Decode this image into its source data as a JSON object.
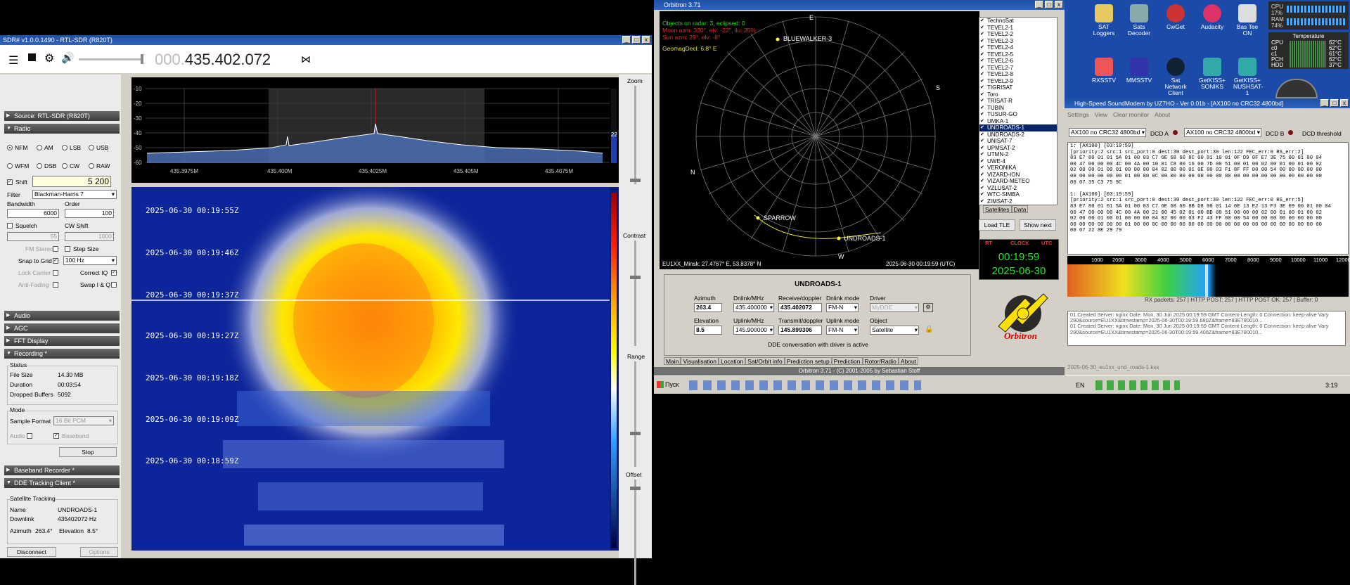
{
  "sdr": {
    "title": "SDR# v1.0.0.1490 - RTL-SDR (R820T)",
    "freq_dim": "000.",
    "freq_main": "435.402.072",
    "sections": {
      "source": "Source: RTL-SDR (R820T)",
      "radio": "Radio",
      "audio": "Audio",
      "agc": "AGC",
      "fft": "FFT Display",
      "recording": "Recording *",
      "baseband": "Baseband Recorder *",
      "dde": "DDE Tracking Client *"
    },
    "modes": [
      "NFM",
      "AM",
      "LSB",
      "USB",
      "WFM",
      "DSB",
      "CW",
      "RAW"
    ],
    "shift_label": "Shift",
    "shift_value": "5 200",
    "filter_label": "Filter",
    "filter_value": "Blackman-Harris 7",
    "bandwidth_label": "Bandwidth",
    "bandwidth_value": "6000",
    "order_label": "Order",
    "order_value": "100",
    "squelch_label": "Squelch",
    "cwshift_label": "CW Shift",
    "squelch_value": "55",
    "cwshift_value": "1000",
    "fm_stereo": "FM Stereo",
    "step_size": "Step Size",
    "snap_label": "Snap to Grid",
    "snap_value": "100 Hz",
    "lock_carrier": "Lock Carrier",
    "correct_iq": "Correct IQ",
    "anti_fading": "Anti-Fading",
    "swap_iq": "Swap I & Q",
    "status_label": "Status",
    "file_size_label": "File Size",
    "file_size": "14.30 MB",
    "duration_label": "Duration",
    "duration": "00:03:54",
    "dropped_label": "Dropped Buffers",
    "dropped": "5092",
    "mode_label": "Mode",
    "sample_format_label": "Sample Format",
    "sample_format": "16 Bit PCM",
    "audio_label": "Audio",
    "baseband_label": "Baseband",
    "stop_label": "Stop",
    "tracking_label": "Satellite Tracking",
    "name_label": "Name",
    "name_value": "UNDROADS-1",
    "downlink_label": "Downlink",
    "downlink_value": "435402072 Hz",
    "azimuth_label": "Azimuth",
    "azimuth_value": "263.4°",
    "elevation_label": "Elevation",
    "elevation_value": "8.5°",
    "disconnect": "Disconnect",
    "options": "Options",
    "zoom": "Zoom",
    "contrast": "Contrast",
    "range": "Range",
    "offset": "Offset",
    "spec_y": [
      "-10",
      "-20",
      "-30",
      "-40",
      "-50",
      "-60"
    ],
    "spec_x": [
      "435.3975M",
      "435.400M",
      "435.4025M",
      "435.405M",
      "435.4075M"
    ],
    "spec_val": "22",
    "wf_times": [
      "2025-06-30 00:19:55Z",
      "2025-06-30 00:19:46Z",
      "2025-06-30 00:19:37Z",
      "2025-06-30 00:19:27Z",
      "2025-06-30 00:19:18Z",
      "2025-06-30 00:19:09Z",
      "2025-06-30 00:18:59Z"
    ]
  },
  "orbitron": {
    "title": "Orbitron 3.71",
    "info1": "Objects on radar: 3, eclipsed: 0",
    "info2": "Moon azm: 330°, elv: -22°, ilu: 25%",
    "info3": "Sun azm: 29°, elv: -8°",
    "info4": "GeomagDecl: 6.8° E",
    "compass": {
      "n": "N",
      "e": "E",
      "s": "S",
      "w": "W"
    },
    "sats_on_radar": [
      "BLUEWALKER-3",
      "SPARROW",
      "UNDROADS-1"
    ],
    "location": "EU1XX_Minsk: 27.4767° E, 53.8378° N",
    "datetime": "2025-06-30 00:19:59 (UTC)",
    "satlist": [
      "TechnoSat",
      "TEVEL2-1",
      "TEVEL2-2",
      "TEVEL2-3",
      "TEVEL2-4",
      "TEVEL2-5",
      "TEVEL2-6",
      "TEVEL2-7",
      "TEVEL2-8",
      "TEVEL2-9",
      "TIGRISAT",
      "Toro",
      "TRISAT-R",
      "TUBIN",
      "TUSUR-GO",
      "UMKA-1",
      "UNDROADS-1",
      "UNDROADS-2",
      "UNISAT-7",
      "UPMSAT-2",
      "UTMN-2",
      "UWE-4",
      "VERONIKA",
      "VIZARD-ION",
      "VIZARD-METEO",
      "VZLUSAT-2",
      "WTC-SIMBA",
      "ZIMSAT-2"
    ],
    "list_tabs": [
      "Satellites",
      "Data"
    ],
    "load_tle": "Load TLE",
    "show_next": "Show next",
    "clock_tabs": [
      "RT",
      "CLOCK",
      "UTC"
    ],
    "clock_time": "00:19:59",
    "clock_date": "2025-06-30",
    "sat_name": "UNDROADS-1",
    "azimuth_label": "Azimuth",
    "azimuth": "263.4",
    "dnlink_label": "Dnlink/MHz",
    "dnlink": "435.400000",
    "rxdop_label": "Receive/doppler",
    "rxdop": "435.402072",
    "dnmode_label": "Dnlink mode",
    "dnmode": "FM-N",
    "driver_label": "Driver",
    "driver": "MyDDE",
    "elev_label": "Elevation",
    "elev": "8.5",
    "uplink_label": "Uplink/MHz",
    "uplink": "145.900000",
    "txdop_label": "Transmit/doppler",
    "txdop": "145.899306",
    "upmode_label": "Uplink mode",
    "upmode": "FM-N",
    "object_label": "Object",
    "object": "Satellite",
    "dde_status": "DDE conversation with driver is active",
    "tabs": [
      "Main",
      "Visualisation",
      "Location",
      "Sat/Orbit info",
      "Prediction setup",
      "Prediction",
      "Rotor/Radio",
      "About"
    ],
    "footer": "Orbitron 3.71 - (C) 2001-2005 by Sebastian Stoff",
    "logo": "Orbitron"
  },
  "desktop": {
    "icons": [
      "SAT Loggers",
      "Sats Decoder",
      "CwGet",
      "Audacity",
      "Bas Tee ON",
      "RXSSTV",
      "MMSSTV",
      "Sat Network Client",
      "GetKISS+ SONIKS",
      "GetKISS+ NUSHSAT-1"
    ],
    "cpu_label": "CPU",
    "cpu": "17%",
    "ram_label": "RAM",
    "ram": "74%",
    "temp_title": "Temperature",
    "temps": [
      {
        "k": "CPU",
        "v": "62°C"
      },
      {
        "k": "c0",
        "v": "62°C"
      },
      {
        "k": "c1",
        "v": "61°C"
      },
      {
        "k": "PCH",
        "v": "62°C"
      },
      {
        "k": "HDD",
        "v": "37°C"
      }
    ]
  },
  "modem": {
    "title": "High-Speed SoundModem by UZ7HO - Ver 0.01b - [AX100 no CRC32 4800bd]",
    "menu": [
      "Settings",
      "View",
      "Clear monitor",
      "About"
    ],
    "mode_a": "AX100 no CRC32 4800bd",
    "dcd_a": "DCD A",
    "mode_b": "AX100 no CRC32 4800bd",
    "dcd_b": "DCD B",
    "dcd_threshold": "DCD threshold",
    "log": "1: [AX100] [03:19:59]\n[priority:2 src:1 src_port:0 dest:30 dest_port:30 len:122 FEC_err:0 RS_err:2]\n83 E7 80 01 01 5A 01 00 03 C7 6E 68 60 8C 00 01 10 01 0F D9 0F E7 3E 75 00 01 00 04\n00 47 00 00 00 4C 00 4A 00 10 01 C8 00 16 00 7D 00 51 00 01 00 02 00 01 00 01 00 02\n02 00 00 01 00 01 00 00 00 04 02 00 00 01 0E 00 03 F1 8F FF 00 00 54 00 00 00 00 00\n00 00 00 00 00 00 01 00 00 0C 00 00 00 00 00 00 00 00 00 00 00 00 00 00 00 00 00 00\n00 07 35 C3 75 9C\n\n1: [AX100] [03:19:59]\n[priority:2 src:1 src_port:0 dest:30 dest_port:30 len:122 FEC_err:0 RS_err:5]\n83 E7 80 01 01 5A 01 00 03 C7 6E 68 60 8B D8 00 01 14 0E 13 E2 13 F3 3E 09 00 01 00 04\n00 47 00 00 00 4C 00 4A 00 21 00 45 02 01 00 BD 00 51 00 00 00 02 00 01 00 01 00 02\n02 00 00 01 00 01 00 00 00 04 02 00 00 03 F2 43 FF 00 00 54 00 00 00 00 00 00 00 00\n00 00 00 00 00 00 01 00 00 0C 00 00 00 00 00 00 00 00 00 00 00 00 00 00 00 00 00 00\n00 07 22 8E 29 79",
    "freq_scale": [
      "1000",
      "2000",
      "3000",
      "4000",
      "5000",
      "6000",
      "7000",
      "8000",
      "9000",
      "10000",
      "11000",
      "12000"
    ],
    "rx_packets": "RX packets: 257 | HTTP POST: 257 | HTTP POST OK: 257 | Buffer: 0",
    "log2": "01 Created Server: nginx Date: Mon, 30 Jun 2025 00:19:59 GMT Content-Length: 0 Connection: keep-alive Vary\n290&source=EU1XX&timestamp=2025-06-30T00:19:59.680Z&frame=83E780010...\n01 Created Server: nginx Date: Mon, 30 Jun 2025 00:19:59 GMT Content-Length: 0 Connection: keep-alive Vary\n290&source=EU1XX&timestamp=2025-06-30T00:19:59.400Z&frame=83E780010...",
    "status_file": "2025-06-30_eu1xx_und_roads-1.kss"
  },
  "taskbar": {
    "start": "Пуск",
    "lang": "EN",
    "time": "3:19"
  }
}
